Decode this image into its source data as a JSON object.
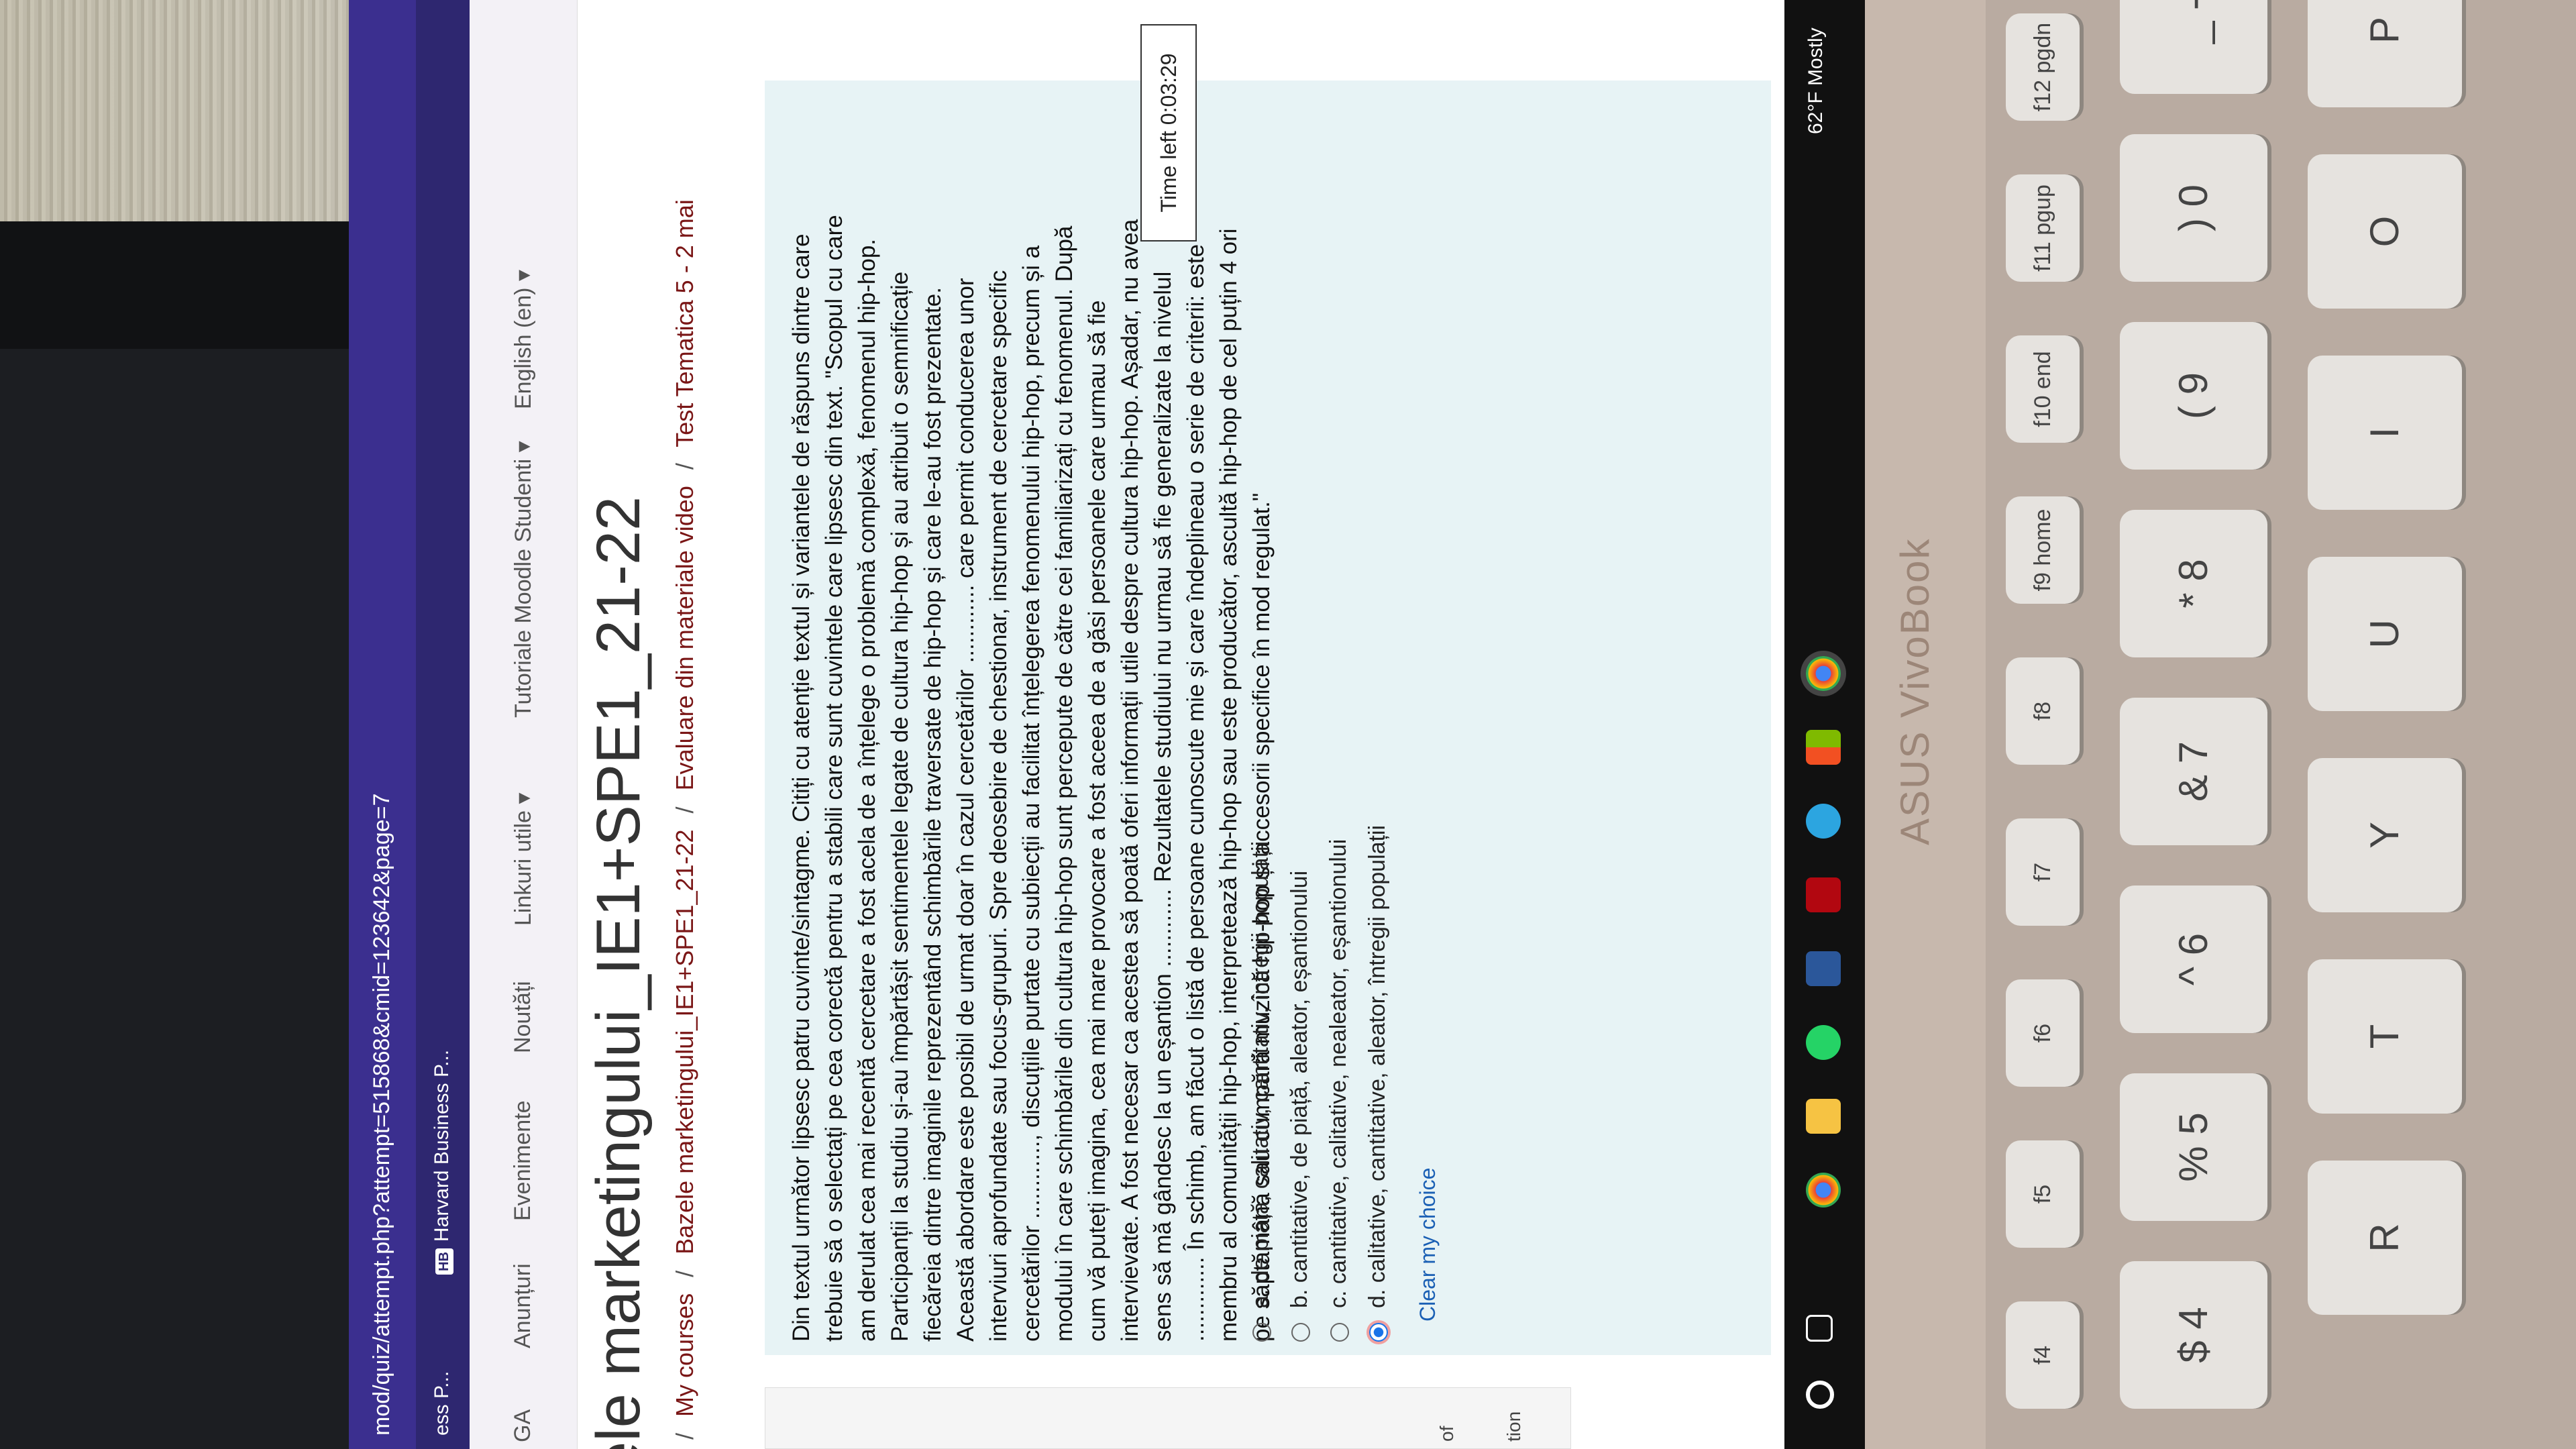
{
  "browser": {
    "url": "mod/quiz/attempt.php?attempt=515868&cmid=123642&page=7",
    "bookmarks": [
      "ess P...",
      "Harvard Business P..."
    ]
  },
  "nav": {
    "items": [
      "GA",
      "Anunțuri",
      "Evenimente",
      "Noutăți",
      "Linkuri utile ▾",
      "Tutoriale Moodle Studenti ▾",
      "English (en) ▾"
    ]
  },
  "page": {
    "course_title": "ele marketingului_IE1+SPE1_21-22",
    "breadcrumb": [
      "My courses",
      "Bazele marketingului_IE1+SPE1_21-22",
      "Evaluare din materiale video",
      "Test Tematica 5 - 2 mai"
    ],
    "sidebar_fragments": [
      "of",
      "tion"
    ]
  },
  "quiz": {
    "timer": "Time left 0:03:29",
    "question_text": "Din textul următor lipsesc patru cuvinte/sintagme. Citiți cu atenție textul și variantele de răspuns dintre care trebuie să o selectați pe cea corectă pentru a stabili care sunt cuvintele care lipsesc din text. \"Scopul cu care am derulat cea mai recentă cercetare a fost acela de a înțelege o problemă complexă, fenomenul hip-hop. Participanții la studiu și-au împărtășit sentimentele legate de cultura hip-hop și au atribuit o semnificație fiecăreia dintre imaginile reprezentând schimbările traversate de hip-hop și care le-au fost prezentate. Această abordare este posibil de urmat doar în cazul cercetărilor ............ care permit conducerea unor interviuri aprofundate sau focus-grupuri. Spre deosebire de chestionar, instrument de cercetare specific cercetărilor ............, discuțiile purtate cu subiecții au facilitat înțelegerea fenomenului hip-hop, precum și a modului în care schimbările din cultura hip-hop sunt percepute de către cei familiarizați cu fenomenul. După cum vă puteți imagina, cea mai mare provocare a fost aceea de a găsi persoanele care urmau să fie intervievate. A fost necesar ca acestea să poată oferi informații utile despre cultura hip-hop. Așadar, nu avea sens să mă gândesc la un eșantion ............ Rezultatele studiului nu urmau să fie generalizate la nivelul ............. În schimb, am făcut o listă de persoane cunoscute mie și care îndeplineau o serie de criterii: este membru al comunității hip-hop, interpretează hip-hop sau este producător, ascultă hip-hop de cel puțin 4 ori pe săptămână sau cumpără muzică hip-hop și accesorii specifice în mod regulat.\"",
    "answers": [
      {
        "letter": "a.",
        "text": "de piață, calitativ, cantitativ, întregii populații"
      },
      {
        "letter": "b.",
        "text": "cantitative, de piață, aleator, eșantionului"
      },
      {
        "letter": "c.",
        "text": "cantitative, calitative, nealeator, eșantionului"
      },
      {
        "letter": "d.",
        "text": "calitative, cantitative, aleator, întregii populații"
      }
    ],
    "selected": "d.",
    "clear_choice": "Clear my choice"
  },
  "taskbar": {
    "weather": "62°F Mostly"
  },
  "laptop": {
    "brand": "ASUS VivoBook",
    "keys_row_fn": [
      "f4",
      "f5",
      "f6",
      "f7",
      "f8",
      "f9 home",
      "f10 end",
      "f11 pgup",
      "f12 pgdn"
    ],
    "keys_row_num": [
      "$ 4",
      "% 5",
      "^ 6",
      "& 7",
      "* 8",
      "( 9",
      ") 0",
      "_ -"
    ],
    "keys_row_letters": [
      "R",
      "T",
      "Y",
      "U",
      "I",
      "O",
      "P"
    ]
  },
  "colors": {
    "browser_bar": "#3b2f8f",
    "question_bg": "#e7f3f5",
    "link": "#1a5fb4",
    "breadcrumb": "#7a1616"
  }
}
